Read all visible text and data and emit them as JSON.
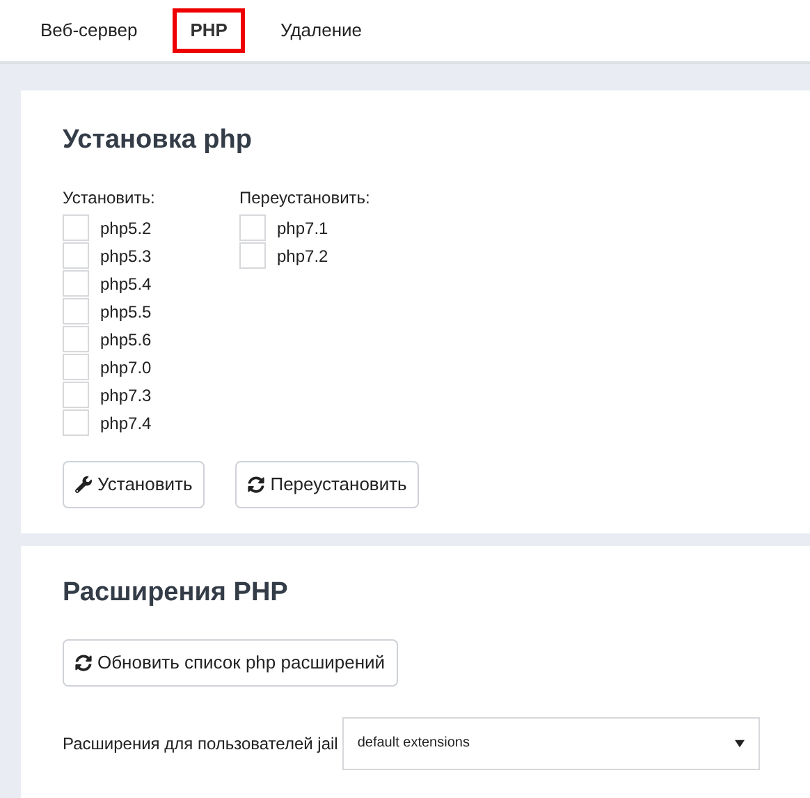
{
  "tabs": [
    {
      "label": "Веб-сервер",
      "selected": false
    },
    {
      "label": "PHP",
      "selected": true
    },
    {
      "label": "Удаление",
      "selected": false
    }
  ],
  "install_section": {
    "title": "Установка php",
    "columns": [
      {
        "heading": "Установить:",
        "items": [
          {
            "label": "php5.2",
            "checked": false
          },
          {
            "label": "php5.3",
            "checked": false
          },
          {
            "label": "php5.4",
            "checked": false
          },
          {
            "label": "php5.5",
            "checked": false
          },
          {
            "label": "php5.6",
            "checked": false
          },
          {
            "label": "php7.0",
            "checked": false
          },
          {
            "label": "php7.3",
            "checked": false
          },
          {
            "label": "php7.4",
            "checked": false
          }
        ]
      },
      {
        "heading": "Переустановить:",
        "items": [
          {
            "label": "php7.1",
            "checked": false
          },
          {
            "label": "php7.2",
            "checked": false
          }
        ]
      }
    ],
    "buttons": [
      {
        "kind": "wrench",
        "label": "Установить"
      },
      {
        "kind": "refresh",
        "label": "Переустановить"
      }
    ]
  },
  "extensions_section": {
    "title": "Расширения PHP",
    "refresh_button": {
      "kind": "refresh",
      "label": "Обновить список php расширений"
    },
    "jail_label": "Расширения для пользователей jail",
    "jail_select": {
      "value": "default extensions"
    }
  }
}
